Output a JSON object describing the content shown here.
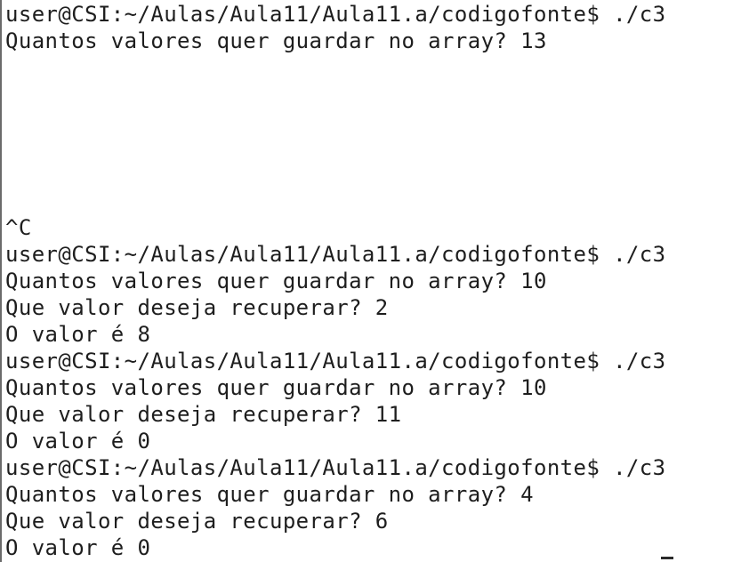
{
  "terminal": {
    "lines": [
      "user@CSI:~/Aulas/Aula11/Aula11.a/codigofonte$ ./c3",
      "Quantos valores quer guardar no array? 13",
      "^C",
      "user@CSI:~/Aulas/Aula11/Aula11.a/codigofonte$ ./c3",
      "Quantos valores quer guardar no array? 10",
      "Que valor deseja recuperar? 2",
      "O valor é 8",
      "user@CSI:~/Aulas/Aula11/Aula11.a/codigofonte$ ./c3",
      "Quantos valores quer guardar no array? 10",
      "Que valor deseja recuperar? 11",
      "O valor é 0",
      "user@CSI:~/Aulas/Aula11/Aula11.a/codigofonte$ ./c3",
      "Quantos valores quer guardar no array? 4",
      "Que valor deseja recuperar? 6",
      "O valor é 0"
    ]
  }
}
